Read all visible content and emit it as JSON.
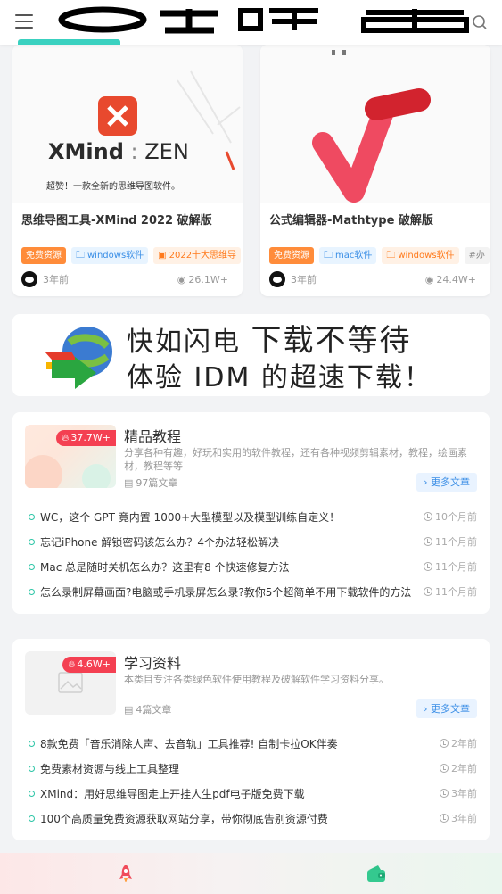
{
  "header": {
    "logo_text": "O 주 哦 菌"
  },
  "posts": [
    {
      "title": "思维导图工具-XMind 2022 破解版",
      "thumb_brand": "XMind",
      "thumb_brand2": "ZEN",
      "thumb_caption": "超赞！一款全新的思维导图软件。",
      "tags": [
        "免费资源",
        "windows软件",
        "2022十大思维导"
      ],
      "time": "3年前",
      "views": "26.1W+"
    },
    {
      "title": "公式编辑器-Mathtype 破解版",
      "tags": [
        "免费资源",
        "mac软件",
        "windows软件",
        "#办"
      ],
      "time": "3年前",
      "views": "24.4W+"
    }
  ],
  "banner": {
    "line1_a": "快如闪电",
    "line1_b": "下载不等待",
    "line2": "体验 IDM 的超速下载！"
  },
  "sections": [
    {
      "title": "精品教程",
      "hot": "37.7W+",
      "desc": "分享各种有趣，好玩和实用的软件教程，还有各种视频剪辑素材，教程，绘画素材，教程等等",
      "count": "97篇文章",
      "more": "更多文章",
      "articles": [
        {
          "title": "WC，这个 GPT 竟内置 1000+大型模型以及模型训练自定义！",
          "time": "10个月前"
        },
        {
          "title": "忘记iPhone 解锁密码该怎么办？4个办法轻松解决",
          "time": "11个月前"
        },
        {
          "title": "Mac 总是随时关机怎么办？这里有8 个快速修复方法",
          "time": "11个月前"
        },
        {
          "title": "怎么录制屏幕画面?电脑或手机录屏怎么录?教你5个超简单不用下载软件的方法",
          "time": "11个月前"
        }
      ]
    },
    {
      "title": "学习资料",
      "hot": "4.6W+",
      "desc": "本类目专注各类绿色软件使用教程及破解软件学习资料分享。",
      "count": "4篇文章",
      "more": "更多文章",
      "articles": [
        {
          "title": "8款免费「音乐消除人声、去音轨」工具推荐! 自制卡拉OK伴奏",
          "time": "2年前"
        },
        {
          "title": "免费素材资源与线上工具整理",
          "time": "2年前"
        },
        {
          "title": "XMind：用好思维导图走上开挂人生pdf电子版免费下载",
          "time": "3年前"
        },
        {
          "title": "100个高质量免费资源获取网站分享，带你彻底告别资源付费",
          "time": "3年前"
        }
      ]
    }
  ],
  "colors": {
    "accent": "#3ad1c0",
    "hot": "#f44052",
    "tag_orange": "#ff8c3a",
    "link_blue": "#3a8ee6"
  }
}
